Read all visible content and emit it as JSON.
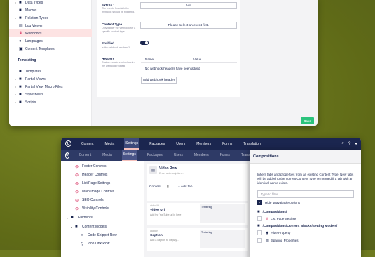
{
  "window1": {
    "sidebar": {
      "items": [
        {
          "label": "Data Types",
          "icon": "folder-icon"
        },
        {
          "label": "Macros",
          "icon": "folder-icon"
        },
        {
          "label": "Relation Types",
          "icon": "folder-icon"
        },
        {
          "label": "Log Viewer",
          "icon": "log-icon"
        },
        {
          "label": "Webhooks",
          "icon": "webhook-icon"
        },
        {
          "label": "Languages",
          "icon": "globe-icon"
        },
        {
          "label": "Content Templates",
          "icon": "template-icon"
        }
      ],
      "templating_header": "Templating",
      "templating_items": [
        {
          "label": "Templates",
          "icon": "folder-icon"
        },
        {
          "label": "Partial Views",
          "icon": "folder-icon"
        },
        {
          "label": "Partial View Macro Files",
          "icon": "folder-icon"
        },
        {
          "label": "Stylesheets",
          "icon": "folder-icon"
        },
        {
          "label": "Scripts",
          "icon": "folder-icon"
        }
      ]
    },
    "form": {
      "events_label": "Events *",
      "events_desc": "The events for which the webhook should be triggered.",
      "events_button": "Add",
      "content_type_label": "Content Type",
      "content_type_desc": "Only trigger the webhook for a specific content type.",
      "content_type_button": "Please select an event first.",
      "enabled_label": "Enabled",
      "enabled_desc": "Is the webhook enabled?",
      "headers_label": "Headers",
      "headers_desc": "Custom headers to include in the webhook request.",
      "col_name": "Name",
      "col_value": "Value",
      "no_headers": "No webhook headers have been added",
      "add_header_button": "Add webhook header"
    },
    "save_button": "Save"
  },
  "window2": {
    "topnav": [
      "Content",
      "Media",
      "Settings",
      "Packages",
      "Users",
      "Members",
      "Forms",
      "Translation"
    ],
    "topnav_active": "Settings",
    "topnav2": [
      "Content",
      "Media",
      "Settings",
      "Packages",
      "Users",
      "Members",
      "Forms",
      "Translation"
    ],
    "sidebar": {
      "items": [
        {
          "label": "Footer Controls",
          "icon": "minus-circle-icon"
        },
        {
          "label": "Header Controls",
          "icon": "minus-circle-icon"
        },
        {
          "label": "List Page Settings",
          "icon": "minus-circle-icon"
        },
        {
          "label": "Main Image Controls",
          "icon": "minus-circle-icon"
        },
        {
          "label": "SEO Controls",
          "icon": "minus-circle-icon"
        },
        {
          "label": "Visibility Controls",
          "icon": "minus-circle-icon"
        },
        {
          "label": "Elements",
          "icon": "folder-icon"
        },
        {
          "label": "Content Models",
          "icon": "folder-icon"
        },
        {
          "label": "Code Snippet Row",
          "icon": "code-icon"
        },
        {
          "label": "Icon Link Row",
          "icon": "link-icon"
        }
      ]
    },
    "editor": {
      "doc_name": "Video Row",
      "doc_desc": "Enter a description...",
      "tab_content": "Content",
      "add_tab": "Add tab",
      "field1_alias": "videoUrl",
      "field1_label": "Video Url",
      "field1_desc": "Add the YouTube url in here",
      "field1_editor": "Textstring",
      "field2_alias": "caption",
      "field2_label": "Caption",
      "field2_desc": "Add a caption to display...",
      "field2_editor": "Textstring"
    },
    "dialog": {
      "title": "Compositions",
      "text": "Inherit tabs and properties from an existing Content Type. New tabs will be added to the current Content Type or merged if a tab with an identical name exists.",
      "filter_placeholder": "Type to filter...",
      "hide_unavailable": "Hide unavailable options",
      "folder1": "/Compositions/",
      "folder1_item": "List Page Settings",
      "folder2": "/Compositions/Content Blocks/Setting Models/",
      "folder2_items": [
        "Hide Property",
        "Spacing Properties"
      ]
    }
  },
  "colors": {
    "background": "#6e7a1f",
    "navy": "#1b264f",
    "accent_pink": "#d42054",
    "save_green": "#2bc37c"
  }
}
